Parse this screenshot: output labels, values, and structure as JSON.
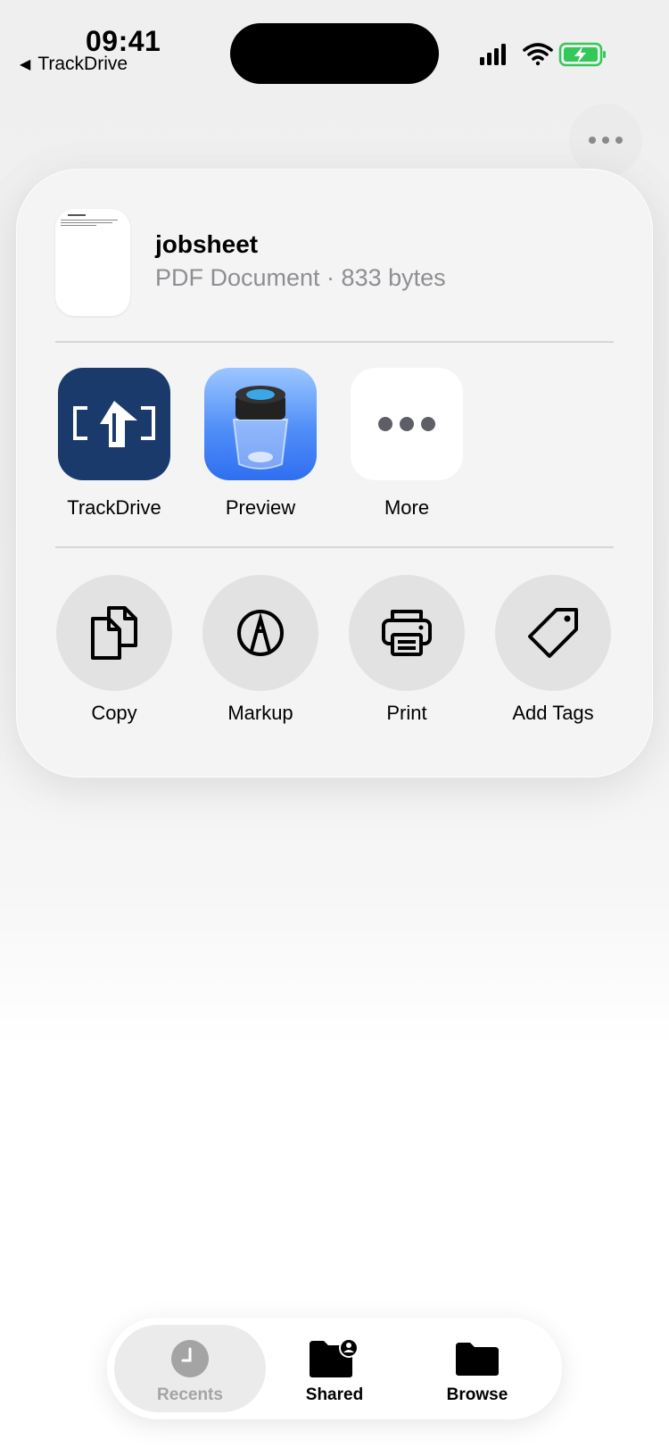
{
  "status_bar": {
    "time": "09:41",
    "back_label": "TrackDrive"
  },
  "share_sheet": {
    "document": {
      "name": "jobsheet",
      "meta": "PDF Document · 833 bytes"
    },
    "apps": [
      {
        "label": "TrackDrive",
        "icon": "trackdrive-app-icon"
      },
      {
        "label": "Preview",
        "icon": "preview-app-icon"
      },
      {
        "label": "More",
        "icon": "more-dots-icon"
      }
    ],
    "actions": [
      {
        "label": "Copy",
        "icon": "copy-icon"
      },
      {
        "label": "Markup",
        "icon": "markup-pen-icon"
      },
      {
        "label": "Print",
        "icon": "printer-icon"
      },
      {
        "label": "Add Tags",
        "icon": "tag-icon"
      }
    ]
  },
  "tab_bar": {
    "tabs": [
      {
        "label": "Recents",
        "icon": "clock-icon",
        "active": true
      },
      {
        "label": "Shared",
        "icon": "shared-folder-icon",
        "active": false
      },
      {
        "label": "Browse",
        "icon": "folder-icon",
        "active": false
      }
    ]
  },
  "colors": {
    "accent_blue": "#1a3a6b",
    "battery_green": "#34c759",
    "inactive_gray": "#a4a4a4"
  }
}
